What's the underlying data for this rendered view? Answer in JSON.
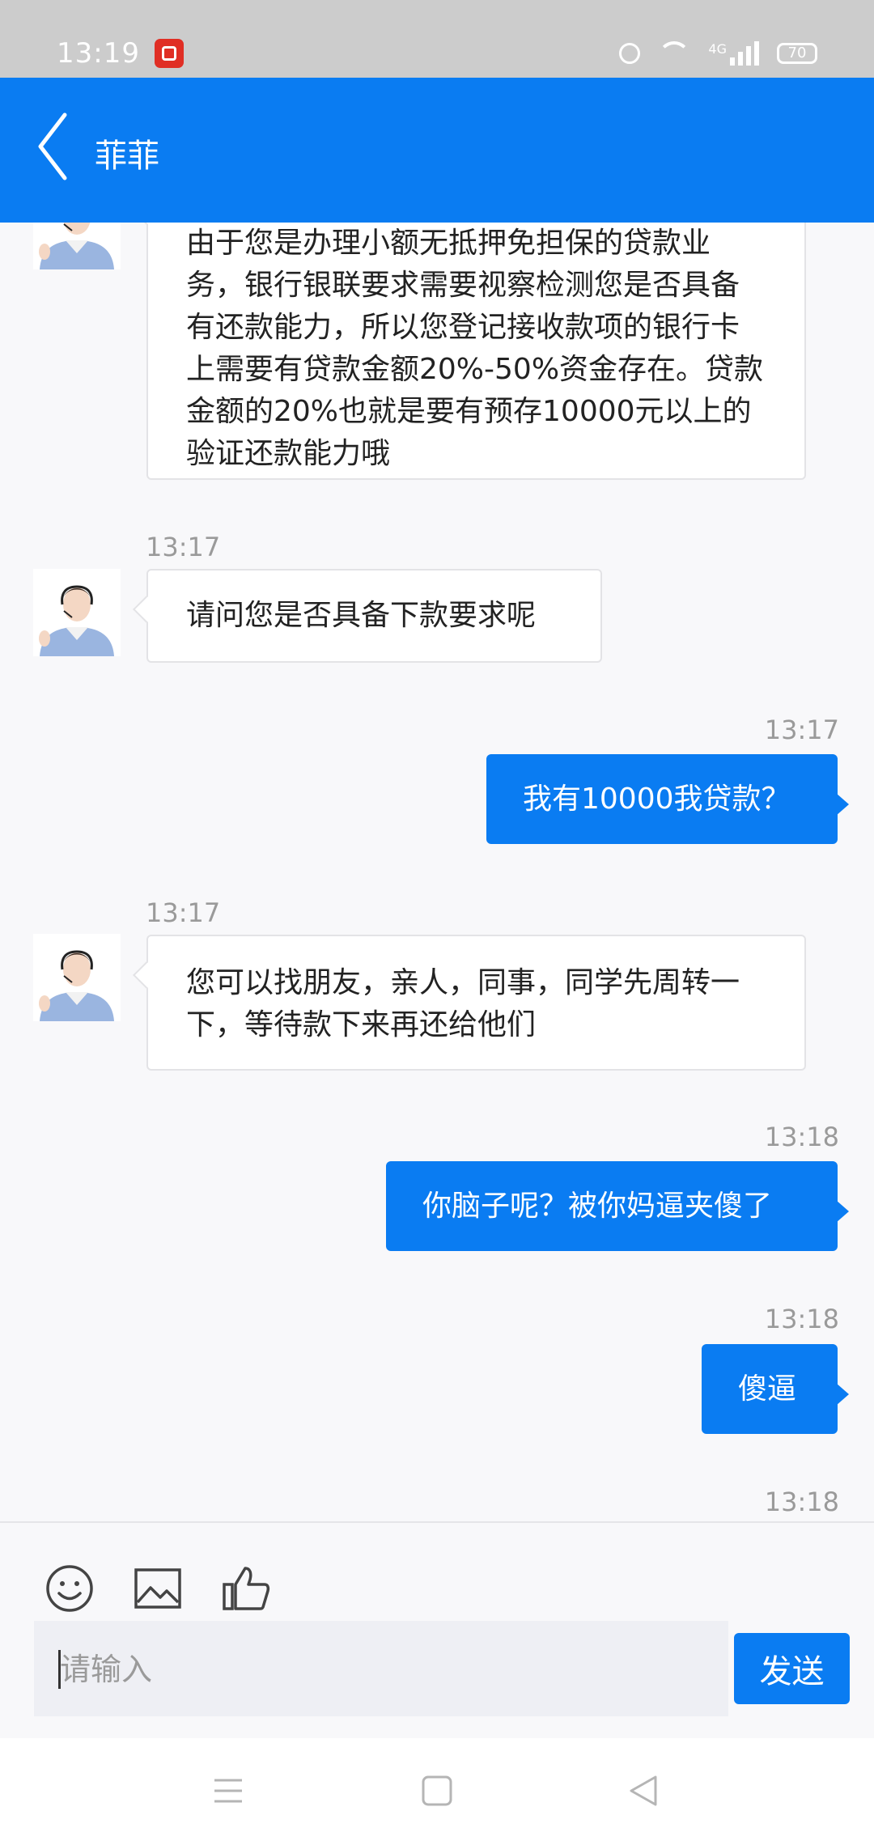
{
  "status_bar": {
    "time": "13:19",
    "network": "4G",
    "battery": "70"
  },
  "header": {
    "title": "菲菲"
  },
  "messages": [
    {
      "side": "left",
      "time": "",
      "text": "由于您是办理小额无抵押免担保的贷款业务，银行银联要求需要视察检测您是否具备有还款能力，所以您登记接收款项的银行卡上需要有贷款金额20%-50%资金存在。贷款金额的20%也就是要有预存10000元以上的验证还款能力哦"
    },
    {
      "side": "left",
      "time": "13:17",
      "text": "请问您是否具备下款要求呢"
    },
    {
      "side": "right",
      "time": "13:17",
      "text": "我有10000我贷款？"
    },
    {
      "side": "left",
      "time": "13:17",
      "text": "您可以找朋友，亲人，同事，同学先周转一下，等待款下来再还给他们"
    },
    {
      "side": "right",
      "time": "13:18",
      "text": "你脑子呢？被你妈逼夹傻了"
    },
    {
      "side": "right",
      "time": "13:18",
      "text": "傻逼"
    },
    {
      "side": "right",
      "time": "13:18",
      "text": ""
    }
  ],
  "composer": {
    "placeholder": "请输入",
    "value": "",
    "send_label": "发送"
  },
  "colors": {
    "accent": "#0a7cf2",
    "status_bar": "#cccccc",
    "background": "#f8f8fa"
  }
}
